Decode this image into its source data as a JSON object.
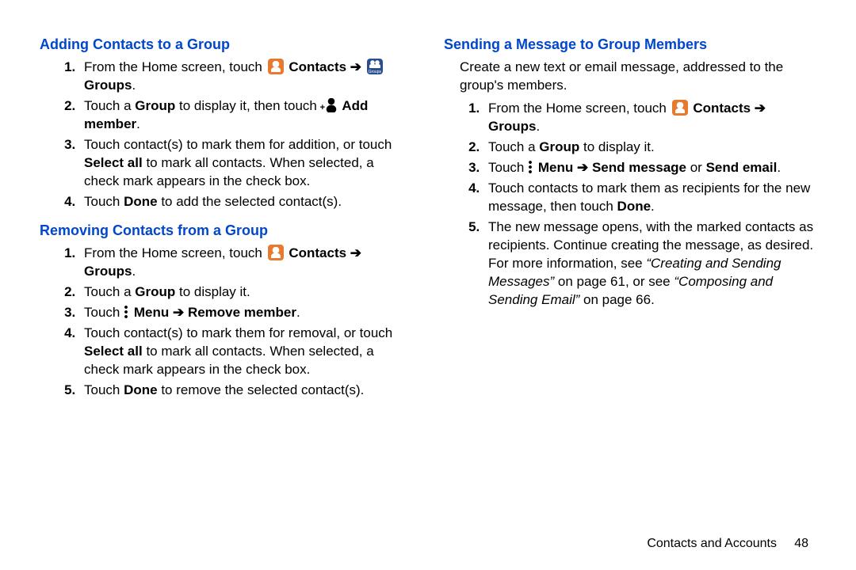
{
  "left": {
    "h_add": "Adding Contacts to a Group",
    "add": {
      "s1a": "From the Home screen, touch ",
      "s1b": "Contacts",
      "s1c": "Groups",
      "s1d": ".",
      "s2a": "Touch a ",
      "s2b": "Group",
      "s2c": " to display it, then touch ",
      "s2d": "Add member",
      "s2e": ".",
      "s3a": "Touch contact(s) to mark them for addition, or touch ",
      "s3b": "Select all",
      "s3c": " to mark all contacts. When selected, a check mark appears in the check box.",
      "s4a": "Touch ",
      "s4b": "Done",
      "s4c": " to add the selected contact(s)."
    },
    "h_remove": "Removing Contacts from a Group",
    "rem": {
      "s1a": "From the Home screen, touch ",
      "s1b": "Contacts",
      "s1c": "Groups",
      "s1d": ".",
      "s2a": "Touch a ",
      "s2b": "Group",
      "s2c": " to display it.",
      "s3a": "Touch ",
      "s3b": "Menu",
      "s3c": "Remove member",
      "s3d": ".",
      "s4a": "Touch contact(s) to mark them for removal, or touch ",
      "s4b": "Select all",
      "s4c": " to mark all contacts. When selected, a check mark appears in the check box.",
      "s5a": "Touch ",
      "s5b": "Done",
      "s5c": " to remove the selected contact(s)."
    }
  },
  "right": {
    "h_send": "Sending a Message to Group Members",
    "intro": "Create a new text or email message, addressed to the group's members.",
    "snd": {
      "s1a": "From the Home screen, touch ",
      "s1b": "Contacts",
      "s1c": "Groups",
      "s1d": ".",
      "s2a": "Touch a ",
      "s2b": "Group",
      "s2c": " to display it.",
      "s3a": "Touch ",
      "s3b": "Menu",
      "s3c": "Send message",
      "s3d": " or ",
      "s3e": "Send email",
      "s3f": ".",
      "s4a": "Touch contacts to mark them as recipients for the new message, then touch ",
      "s4b": "Done",
      "s4c": ".",
      "s5a": "The new message opens, with the marked contacts as recipients. Continue creating the message, as desired. For more information, see ",
      "s5b": "“Creating and Sending Messages”",
      "s5c": " on page 61, or see ",
      "s5d": "“Composing and Sending Email”",
      "s5e": " on page 66."
    }
  },
  "arrow": "➔",
  "footer": {
    "section": "Contacts and Accounts",
    "page": "48"
  }
}
